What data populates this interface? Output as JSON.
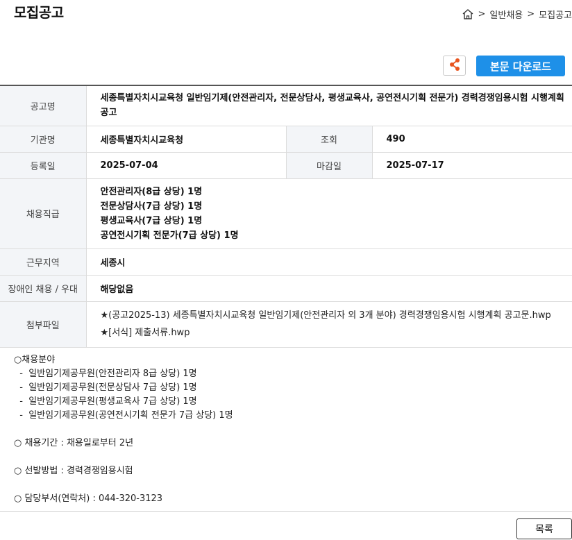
{
  "page": {
    "title": "모집공고"
  },
  "breadcrumb": {
    "sep1": ">",
    "item1": "일반채용",
    "sep2": ">",
    "item2": "모집공고"
  },
  "toolbar": {
    "download_label": "본문 다운로드"
  },
  "info": {
    "notice_label": "공고명",
    "notice_value": "세종특별자치시교육청 일반임기제(안전관리자, 전문상담사, 평생교육사, 공연전시기획 전문가) 경력경쟁임용시험 시행계획 공고",
    "org_label": "기관명",
    "org_value": "세종특별자치시교육청",
    "views_label": "조회",
    "views_value": "490",
    "reg_label": "등록일",
    "reg_value": "2025-07-04",
    "deadline_label": "마감일",
    "deadline_value": "2025-07-17",
    "jobs_label": "채용직급",
    "jobs": [
      "안전관리자(8급 상당) 1명",
      "전문상담사(7급 상당) 1명",
      "평생교육사(7급 상당) 1명",
      "공연전시기획 전문가(7급 상당) 1명"
    ],
    "region_label": "근무지역",
    "region_value": "세종시",
    "disability_label": "장애인 채용 / 우대",
    "disability_value": "해당없음",
    "attach_label": "첨부파일",
    "attachments": [
      "★(공고2025-13) 세종특별자치시교육청 일반임기제(안전관리자 외 3개 분야) 경력경쟁임용시험 시행계획 공고문.hwp",
      "★[서식] 제출서류.hwp"
    ]
  },
  "body": {
    "lines": [
      "○채용분야",
      "  -  일반임기제공무원(안전관리자 8급 상당) 1명",
      "  -  일반임기제공무원(전문상담사 7급 상당) 1명",
      "  -  일반임기제공무원(평생교육사 7급 상당) 1명",
      "  -  일반임기제공무원(공연전시기획 전문가 7급 상당) 1명",
      "",
      "○ 채용기간 : 채용일로부터 2년",
      "",
      "○ 선발방법 : 경력경쟁임용시험",
      "",
      "○ 담당부서(연락처) : 044-320-3123"
    ]
  },
  "footer": {
    "list_label": "목록"
  },
  "icons": {
    "home": "home-icon",
    "share": "share-icon"
  },
  "colors": {
    "accent": "#1e90e8",
    "share_icon": "#e8541e",
    "header_bg": "#f3f5f8"
  }
}
